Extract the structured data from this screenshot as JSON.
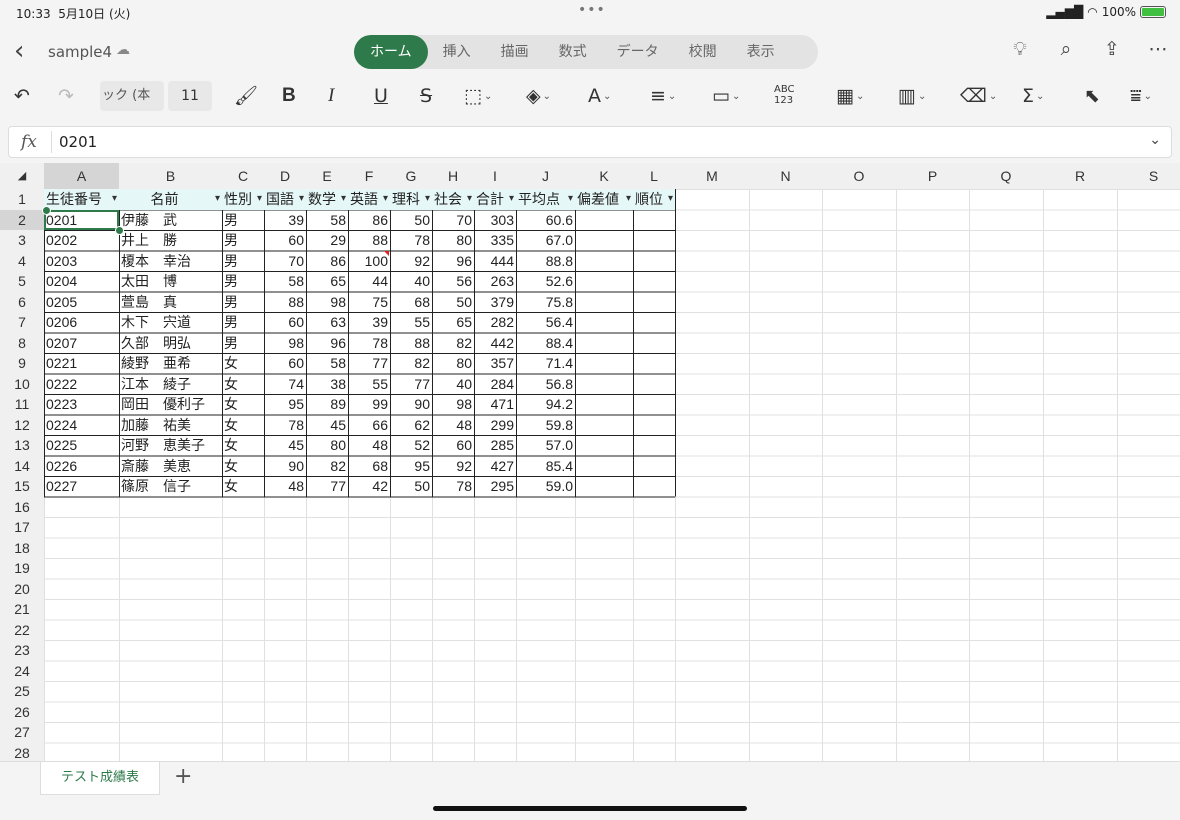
{
  "status": {
    "time": "10:33",
    "date": "5月10日 (火)",
    "battery": "100%"
  },
  "title": {
    "doc": "sample4"
  },
  "tabs": [
    "ホーム",
    "挿入",
    "描画",
    "数式",
    "データ",
    "校閲",
    "表示"
  ],
  "toolbar": {
    "font": "ック (本",
    "size": "11"
  },
  "formula": {
    "value": "0201"
  },
  "columns": [
    "A",
    "B",
    "C",
    "D",
    "E",
    "F",
    "G",
    "H",
    "I",
    "J",
    "K",
    "L",
    "M",
    "N",
    "O",
    "P",
    "Q",
    "R",
    "S"
  ],
  "header": [
    "生徒番号",
    "名前",
    "性別",
    "国語",
    "数学",
    "英語",
    "理科",
    "社会",
    "合計",
    "平均点",
    "偏差値",
    "順位"
  ],
  "rows": [
    [
      "0201",
      "伊藤　武",
      "男",
      "39",
      "58",
      "86",
      "50",
      "70",
      "303",
      "60.6"
    ],
    [
      "0202",
      "井上　勝",
      "男",
      "60",
      "29",
      "88",
      "78",
      "80",
      "335",
      "67.0"
    ],
    [
      "0203",
      "榎本　幸治",
      "男",
      "70",
      "86",
      "100",
      "92",
      "96",
      "444",
      "88.8"
    ],
    [
      "0204",
      "太田　博",
      "男",
      "58",
      "65",
      "44",
      "40",
      "56",
      "263",
      "52.6"
    ],
    [
      "0205",
      "萱島　真",
      "男",
      "88",
      "98",
      "75",
      "68",
      "50",
      "379",
      "75.8"
    ],
    [
      "0206",
      "木下　宍道",
      "男",
      "60",
      "63",
      "39",
      "55",
      "65",
      "282",
      "56.4"
    ],
    [
      "0207",
      "久部　明弘",
      "男",
      "98",
      "96",
      "78",
      "88",
      "82",
      "442",
      "88.4"
    ],
    [
      "0221",
      "綾野　亜希",
      "女",
      "60",
      "58",
      "77",
      "82",
      "80",
      "357",
      "71.4"
    ],
    [
      "0222",
      "江本　綾子",
      "女",
      "74",
      "38",
      "55",
      "77",
      "40",
      "284",
      "56.8"
    ],
    [
      "0223",
      "岡田　優利子",
      "女",
      "95",
      "89",
      "99",
      "90",
      "98",
      "471",
      "94.2"
    ],
    [
      "0224",
      "加藤　祐美",
      "女",
      "78",
      "45",
      "66",
      "62",
      "48",
      "299",
      "59.8"
    ],
    [
      "0225",
      "河野　恵美子",
      "女",
      "45",
      "80",
      "48",
      "52",
      "60",
      "285",
      "57.0"
    ],
    [
      "0226",
      "斎藤　美恵",
      "女",
      "90",
      "82",
      "68",
      "95",
      "92",
      "427",
      "85.4"
    ],
    [
      "0227",
      "篠原　信子",
      "女",
      "48",
      "77",
      "42",
      "50",
      "78",
      "295",
      "59.0"
    ]
  ],
  "row_numbers": [
    "1",
    "2",
    "3",
    "4",
    "5",
    "6",
    "7",
    "8",
    "9",
    "10",
    "11",
    "12",
    "13",
    "14",
    "15",
    "16",
    "17",
    "18",
    "19",
    "20",
    "21",
    "22",
    "23",
    "24",
    "25",
    "26",
    "27",
    "28"
  ],
  "sheet": {
    "name": "テスト成績表",
    "add": "+"
  },
  "colors": {
    "accent": "#2f7a4b",
    "header_fill": "#e6f7f7"
  }
}
